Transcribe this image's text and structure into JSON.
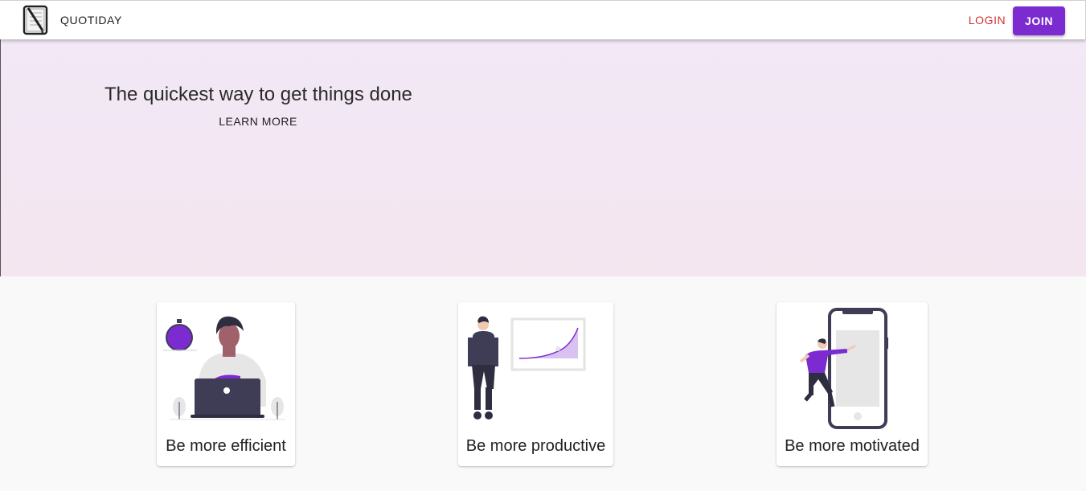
{
  "header": {
    "brand": "QUOTIDAY",
    "logo_icon": "notebook-pen-icon",
    "login_label": "LOGIN",
    "join_label": "JOIN"
  },
  "hero": {
    "title": "The quickest way to get things done",
    "learn_more_label": "LEARN MORE"
  },
  "cards": [
    {
      "title": "Be more efficient",
      "illustration": "person-laptop-stopwatch-illustration"
    },
    {
      "title": "Be more productive",
      "illustration": "person-growth-chart-illustration"
    },
    {
      "title": "Be more motivated",
      "illustration": "person-jumping-phone-illustration"
    }
  ],
  "colors": {
    "accent": "#7b2bd0",
    "login": "#d32f2f",
    "hero_bg": "#f2e8f6"
  }
}
